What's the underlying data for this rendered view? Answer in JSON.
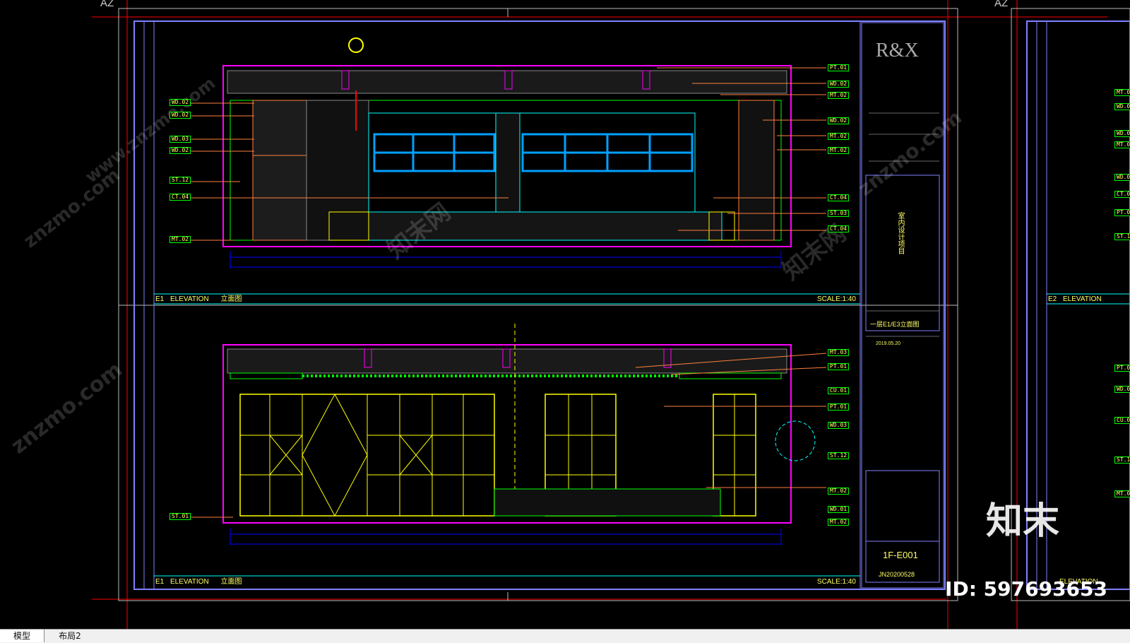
{
  "layout_tabs": [
    {
      "label": "模型"
    },
    {
      "label": "布局2"
    }
  ],
  "corner_labels": {
    "left": "AZ",
    "right": "AZ"
  },
  "title_block": {
    "logo": "R&X",
    "project_vertical": "室内设计项目",
    "drawing_title": "一层E1/E3立面图",
    "date": "2019.05.20",
    "sheet_no": "1F-E001",
    "project_no": "JN20200528"
  },
  "views": [
    {
      "id": "E1",
      "label": "ELEVATION",
      "sub": "立面图",
      "scale": "SCALE:1:40"
    },
    {
      "id": "E1",
      "label": "ELEVATION",
      "sub": "立面图",
      "scale": "SCALE:1:40"
    }
  ],
  "right_sheet_views": [
    {
      "id": "E2",
      "label": "ELEVATION"
    },
    {
      "id": "",
      "label": "ELEVATION"
    }
  ],
  "tags_top_left": [
    "WD.02",
    "WD.02",
    "WD.03",
    "WD.02",
    "ST.12",
    "CT.04",
    "MT.02"
  ],
  "tags_top_right": [
    "PT.01",
    "WD.02",
    "MT.02",
    "WD.02",
    "MT.02",
    "MT.02",
    "CT.04",
    "ST.03",
    "CT.04"
  ],
  "tags_bottom_left": [
    "ST.01"
  ],
  "tags_bottom_right": [
    "MT.03",
    "PT.01",
    "CU.01",
    "PT.01",
    "WD.03",
    "ST.12",
    "MT.02",
    "WD.01",
    "MT.02"
  ],
  "tags_right_sheet": [
    "MT.0",
    "WD.0",
    "WD.0",
    "MT.0",
    "WD.0",
    "CT.0",
    "PT.0",
    "ST.1",
    "PT.0",
    "WD.0",
    "CU.0",
    "ST.1",
    "MT.0"
  ],
  "watermarks": [
    "znzmo.com",
    "www.znzmo.com",
    "知末网"
  ],
  "brand": "知末",
  "id_label": "ID: 597693653",
  "colors": {
    "frame_blue": "#8080ff",
    "cyan": "#00ffff",
    "magenta": "#ff00ff",
    "green": "#00ff00",
    "yellow": "#ffff00",
    "red": "#ff0000",
    "orange": "#ff8040"
  }
}
